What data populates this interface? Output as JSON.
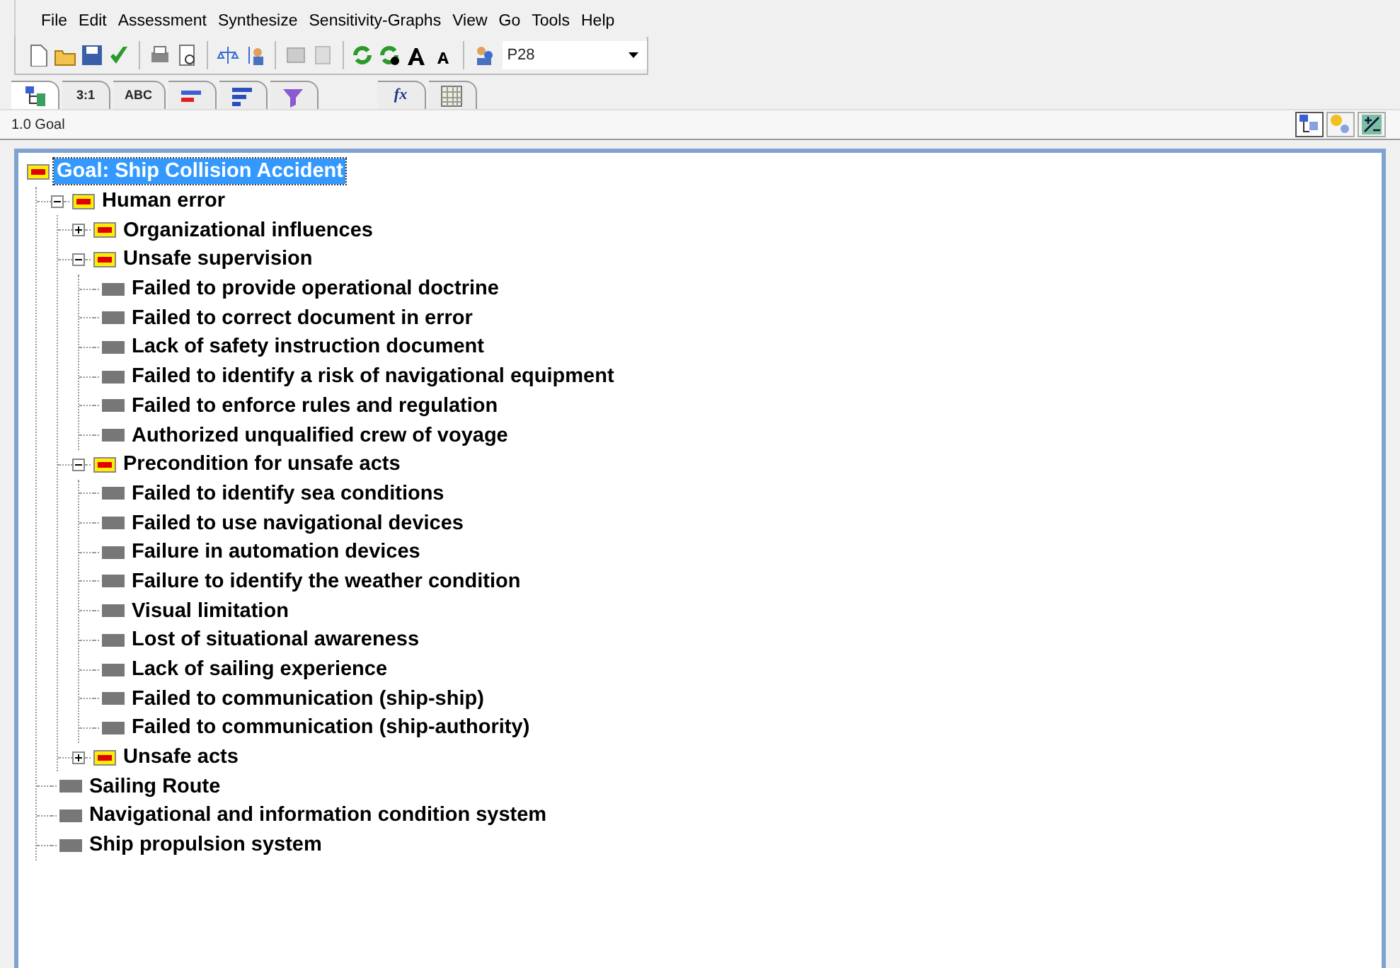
{
  "menu": [
    "File",
    "Edit",
    "Assessment",
    "Synthesize",
    "Sensitivity-Graphs",
    "View",
    "Go",
    "Tools",
    "Help"
  ],
  "toolbar": {
    "combo_value": "P28"
  },
  "tabs": [
    {
      "kind": "tree",
      "selected": true
    },
    {
      "kind": "text",
      "label": "3:1",
      "selected": false
    },
    {
      "kind": "text",
      "label": "ABC",
      "selected": false
    },
    {
      "kind": "redbars",
      "selected": false
    },
    {
      "kind": "bars",
      "selected": false
    },
    {
      "kind": "funnel",
      "selected": false
    },
    {
      "kind": "formula",
      "label": "fx",
      "selected": false
    },
    {
      "kind": "grid",
      "selected": false
    }
  ],
  "breadcrumb": "1.0 Goal",
  "view_buttons": [
    {
      "kind": "tree",
      "selected": true
    },
    {
      "kind": "nodes",
      "selected": false
    },
    {
      "kind": "edit",
      "selected": false
    }
  ],
  "tree": {
    "label": "Goal: Ship Collision Accident",
    "kind": "cluster",
    "selected": true,
    "children": [
      {
        "label": "Human error",
        "kind": "cluster",
        "expanded": true,
        "children": [
          {
            "label": "Organizational influences",
            "kind": "cluster",
            "expanded": false
          },
          {
            "label": "Unsafe supervision",
            "kind": "cluster",
            "expanded": true,
            "children": [
              {
                "label": "Failed to provide operational doctrine",
                "kind": "leaf"
              },
              {
                "label": "Failed to correct document in error",
                "kind": "leaf"
              },
              {
                "label": "Lack of safety instruction document",
                "kind": "leaf"
              },
              {
                "label": "Failed to identify a risk of navigational equipment",
                "kind": "leaf"
              },
              {
                "label": "Failed to enforce rules and regulation",
                "kind": "leaf"
              },
              {
                "label": "Authorized unqualified crew of voyage",
                "kind": "leaf"
              }
            ]
          },
          {
            "label": "Precondition for unsafe acts",
            "kind": "cluster",
            "expanded": true,
            "children": [
              {
                "label": "Failed to identify sea conditions",
                "kind": "leaf"
              },
              {
                "label": "Failed to use navigational devices",
                "kind": "leaf"
              },
              {
                "label": "Failure in automation devices",
                "kind": "leaf"
              },
              {
                "label": "Failure to identify the weather condition",
                "kind": "leaf"
              },
              {
                "label": "Visual limitation",
                "kind": "leaf"
              },
              {
                "label": "Lost of situational awareness",
                "kind": "leaf"
              },
              {
                "label": "Lack of sailing experience",
                "kind": "leaf"
              },
              {
                "label": "Failed to communication (ship-ship)",
                "kind": "leaf"
              },
              {
                "label": "Failed to communication (ship-authority)",
                "kind": "leaf"
              }
            ]
          },
          {
            "label": "Unsafe acts",
            "kind": "cluster",
            "expanded": false
          }
        ]
      },
      {
        "label": "Sailing Route",
        "kind": "leaf"
      },
      {
        "label": "Navigational and information condition system",
        "kind": "leaf"
      },
      {
        "label": "Ship propulsion system",
        "kind": "leaf"
      }
    ]
  }
}
